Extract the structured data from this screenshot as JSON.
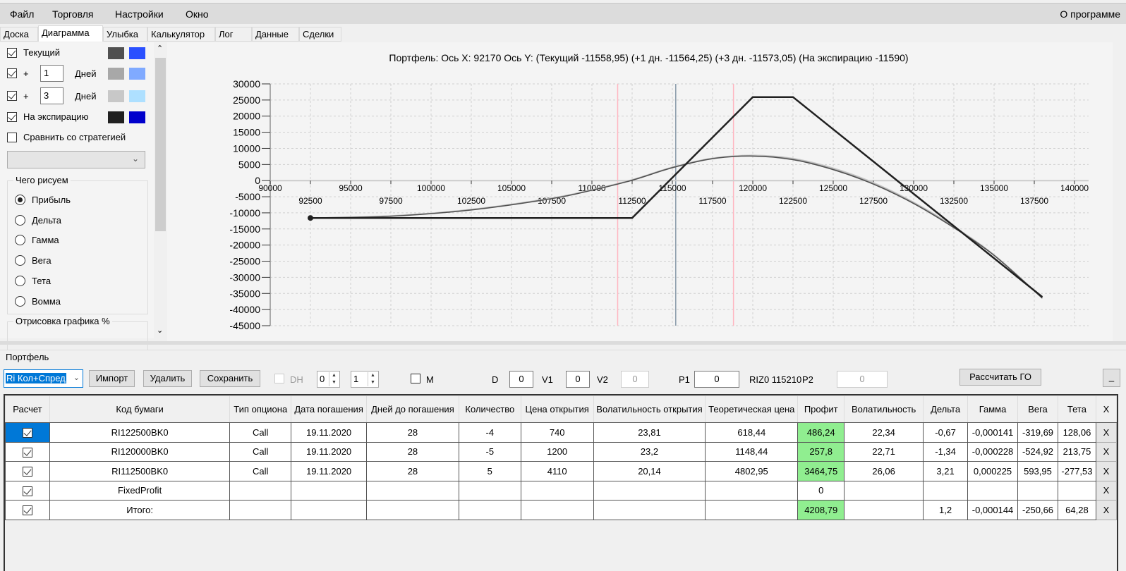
{
  "menu": {
    "items": [
      "Файл",
      "Торговля",
      "Настройки",
      "Окно"
    ],
    "about": "О программе"
  },
  "tabs": [
    {
      "label": "Доска"
    },
    {
      "label": "Диаграмма",
      "selected": true
    },
    {
      "label": "Улыбка"
    },
    {
      "label": "Калькулятор"
    },
    {
      "label": "Лог"
    },
    {
      "label": "Данные"
    },
    {
      "label": "Сделки"
    }
  ],
  "left": {
    "current": {
      "label": "Текущий",
      "checked": true,
      "colors": [
        "#505050",
        "#2a50ff"
      ]
    },
    "plus1": {
      "prefix": "+",
      "value": "1",
      "unit": "Дней",
      "checked": true,
      "colors": [
        "#a8a8a8",
        "#80aaff"
      ]
    },
    "plus3": {
      "prefix": "+",
      "value": "3",
      "unit": "Дней",
      "checked": true,
      "colors": [
        "#c8c8c8",
        "#aee0ff"
      ]
    },
    "expiration": {
      "label": "На экспирацию",
      "checked": true,
      "colors": [
        "#202020",
        "#0000cc"
      ]
    },
    "compare": {
      "label": "Сравнить со стратегией",
      "checked": false
    },
    "what_title": "Чего рисуем",
    "what_options": [
      "Прибыль",
      "Дельта",
      "Гамма",
      "Вега",
      "Тета",
      "Вомма"
    ],
    "what_selected": 0,
    "render_title": "Отрисовка графика %"
  },
  "chart_data": {
    "type": "line",
    "title": "Портфель: Ось X: 92170 Ось Y:  (Текущий -11558,95)  (+1 дн. -11564,25)  (+3 дн. -11573,05)  (На экспирацию -11590)",
    "xlim": [
      90000,
      140000
    ],
    "ylim": [
      -45000,
      30000
    ],
    "x_ticks_major": [
      90000,
      95000,
      100000,
      105000,
      110000,
      115000,
      120000,
      125000,
      130000,
      135000,
      140000
    ],
    "x_ticks_minor": [
      92500,
      97500,
      102500,
      107500,
      112500,
      117500,
      122500,
      127500,
      132500,
      137500
    ],
    "y_ticks": [
      30000,
      25000,
      20000,
      15000,
      10000,
      5000,
      0,
      -5000,
      -10000,
      -15000,
      -20000,
      -25000,
      -30000,
      -35000,
      -40000,
      -45000
    ],
    "grid": true,
    "vlines": [
      {
        "x": 111600,
        "color": "#ffb6c1"
      },
      {
        "x": 115210,
        "color": "#8a9aaa"
      },
      {
        "x": 118800,
        "color": "#ffb6c1"
      }
    ],
    "series": [
      {
        "key": "plus3",
        "color": "#c8c8c8",
        "points": [
          [
            92500,
            -11573
          ],
          [
            97500,
            -10900
          ],
          [
            102500,
            -8900
          ],
          [
            107500,
            -5400
          ],
          [
            110000,
            -2800
          ],
          [
            112500,
            300
          ],
          [
            115000,
            4200
          ],
          [
            117500,
            7000
          ],
          [
            120000,
            7900
          ],
          [
            122500,
            6900
          ],
          [
            125000,
            3900
          ],
          [
            127500,
            -600
          ],
          [
            130000,
            -6700
          ],
          [
            132500,
            -14200
          ],
          [
            135000,
            -23000
          ],
          [
            138000,
            -36300
          ]
        ]
      },
      {
        "key": "plus1",
        "color": "#a8a8a8",
        "points": [
          [
            92500,
            -11564
          ],
          [
            97500,
            -11000
          ],
          [
            102500,
            -9000
          ],
          [
            107500,
            -5500
          ],
          [
            110000,
            -2900
          ],
          [
            112500,
            200
          ],
          [
            115000,
            4100
          ],
          [
            117500,
            6900
          ],
          [
            120000,
            7700
          ],
          [
            122500,
            6700
          ],
          [
            125000,
            3600
          ],
          [
            127500,
            -900
          ],
          [
            130000,
            -6900
          ],
          [
            132500,
            -14400
          ],
          [
            135000,
            -23100
          ],
          [
            138000,
            -36400
          ]
        ]
      },
      {
        "key": "current",
        "color": "#505050",
        "points": [
          [
            92500,
            -11559
          ],
          [
            97500,
            -11050
          ],
          [
            102500,
            -9100
          ],
          [
            107500,
            -5600
          ],
          [
            110000,
            -3000
          ],
          [
            112500,
            100
          ],
          [
            115000,
            4000
          ],
          [
            117500,
            6800
          ],
          [
            120000,
            7600
          ],
          [
            122500,
            6500
          ],
          [
            125000,
            3400
          ],
          [
            127500,
            -1100
          ],
          [
            130000,
            -7100
          ],
          [
            132500,
            -14600
          ],
          [
            135000,
            -23200
          ],
          [
            138000,
            -36500
          ]
        ]
      },
      {
        "key": "expiration",
        "color": "#202020",
        "points": [
          [
            92500,
            -11590
          ],
          [
            112500,
            -11590
          ],
          [
            120000,
            25910
          ],
          [
            122500,
            25910
          ],
          [
            138000,
            -36090
          ]
        ]
      }
    ]
  },
  "portfolio": {
    "title": "Портфель",
    "selected": "Ri Кол+Спред",
    "import": "Импорт",
    "delete": "Удалить",
    "save": "Сохранить",
    "dh_label": "DH",
    "dh_checked": false,
    "spin1": "0",
    "spin2": "1",
    "m_label": "M",
    "m_checked": false,
    "d_label": "D",
    "d_value": "0",
    "v1_label": "V1",
    "v1_value": "0",
    "v2_label": "V2",
    "v2_value": "0",
    "p1_label": "P1",
    "p1_value": "0",
    "riz": "RIZ0 115210",
    "p2_label": "P2",
    "p2_value": "0",
    "calc_go": "Рассчитать ГО",
    "minimize": "_"
  },
  "table": {
    "headers": [
      "Расчет",
      "Код бумаги",
      "Тип опциона",
      "Дата погашения",
      "Дней до погашения",
      "Количество",
      "Цена открытия",
      "Волатильность открытия",
      "Теоретическая цена",
      "Профит",
      "Волатильность",
      "Дельта",
      "Гамма",
      "Вега",
      "Тета",
      "X"
    ],
    "rows": [
      {
        "checked": true,
        "cells": [
          "RI122500BK0",
          "Call",
          "19.11.2020",
          "28",
          "-4",
          "740",
          "23,81",
          "618,44",
          "486,24",
          "22,34",
          "-0,67",
          "-0,000141",
          "-319,69",
          "128,06"
        ],
        "green": true
      },
      {
        "checked": true,
        "cells": [
          "RI120000BK0",
          "Call",
          "19.11.2020",
          "28",
          "-5",
          "1200",
          "23,2",
          "1148,44",
          "257,8",
          "22,71",
          "-1,34",
          "-0,000228",
          "-524,92",
          "213,75"
        ],
        "green": true
      },
      {
        "checked": true,
        "cells": [
          "RI112500BK0",
          "Call",
          "19.11.2020",
          "28",
          "5",
          "4110",
          "20,14",
          "4802,95",
          "3464,75",
          "26,06",
          "3,21",
          "0,000225",
          "593,95",
          "-277,53"
        ],
        "green": true
      },
      {
        "checked": true,
        "cells": [
          "FixedProfit",
          "",
          "",
          "",
          "",
          "",
          "",
          "",
          "0",
          "",
          "",
          "",
          "",
          ""
        ],
        "green": false
      },
      {
        "checked": true,
        "cells": [
          "Итого:",
          "",
          "",
          "",
          "",
          "",
          "",
          "",
          "4208,79",
          "",
          "1,2",
          "-0,000144",
          "-250,66",
          "64,28"
        ],
        "green": true
      }
    ],
    "remove_label": "X"
  }
}
